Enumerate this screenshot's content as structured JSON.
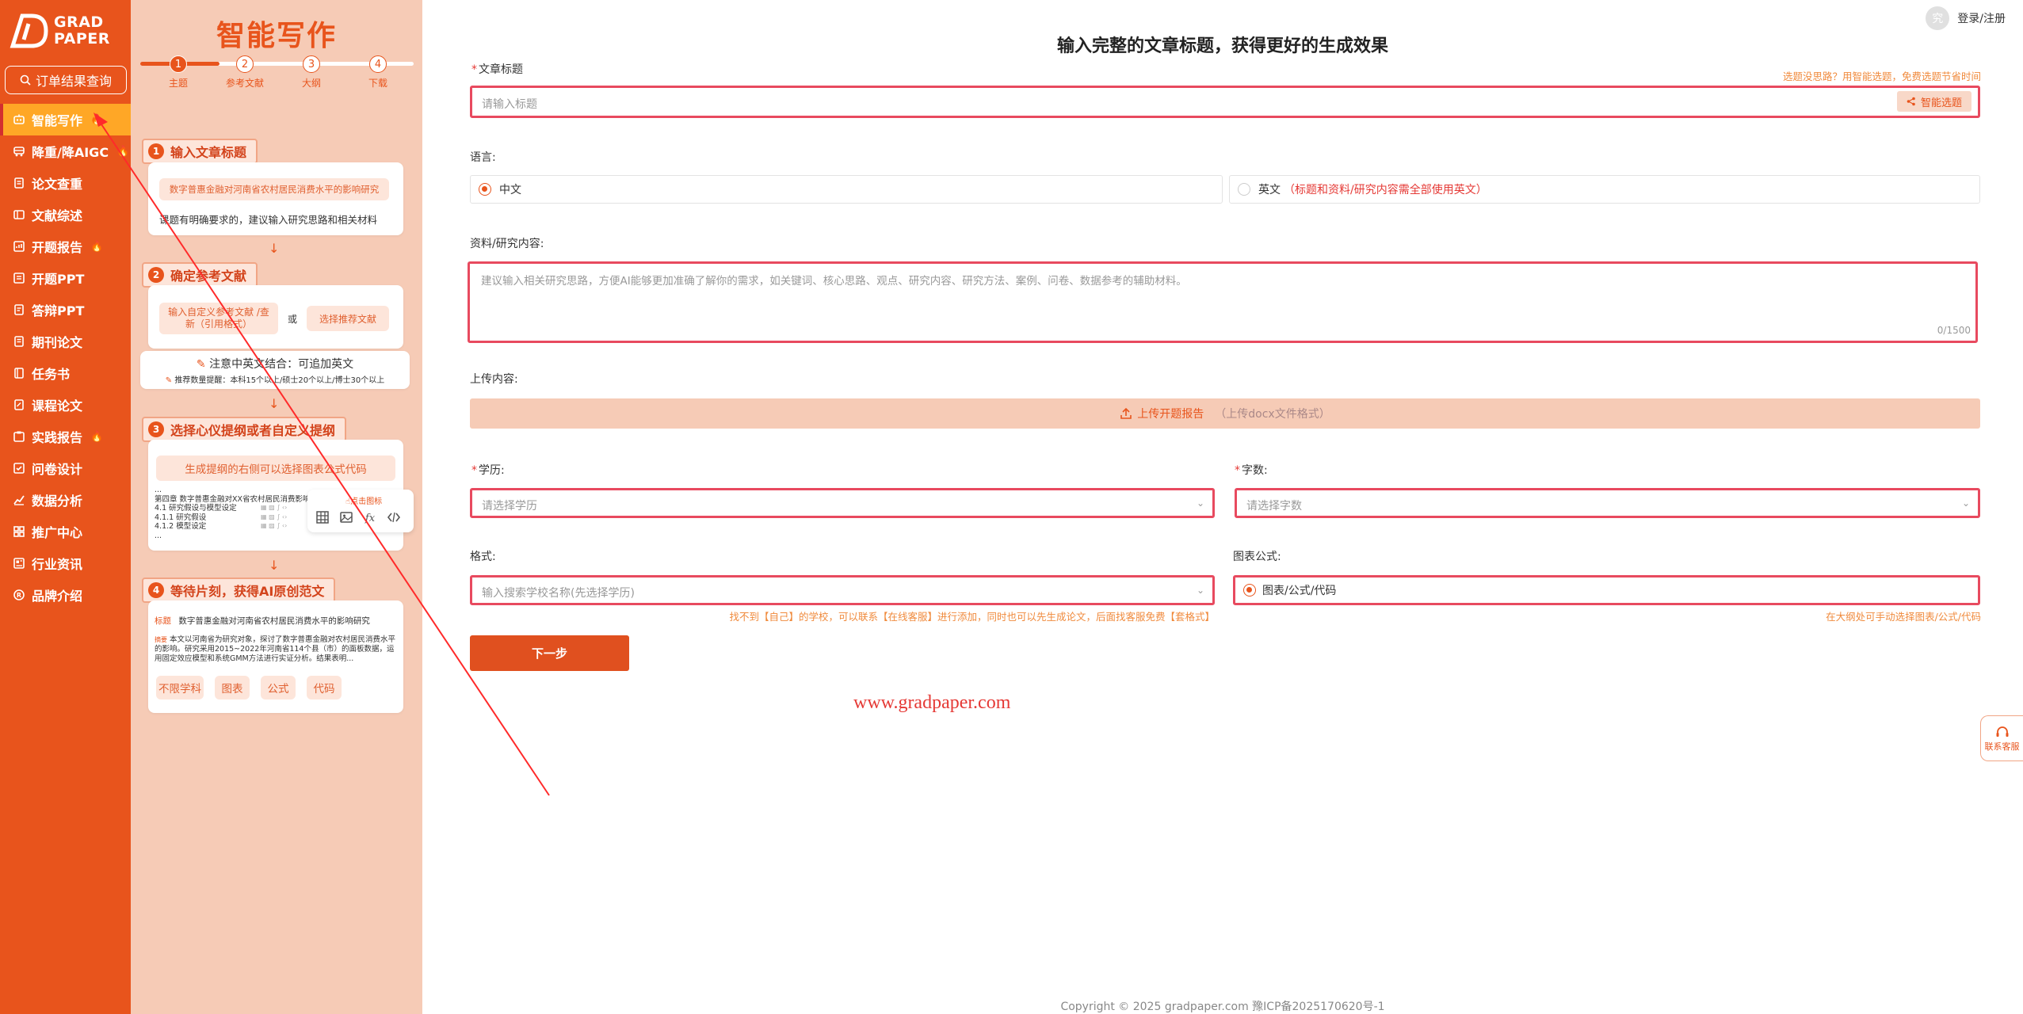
{
  "brand": {
    "name_line1": "GRAD",
    "name_line2": "PAPER"
  },
  "sidebar": {
    "order_query": "订单结果查询",
    "items": [
      {
        "label": "智能写作",
        "hot": true,
        "active": true
      },
      {
        "label": "降重/降AIGC",
        "hot": true
      },
      {
        "label": "论文查重"
      },
      {
        "label": "文献综述"
      },
      {
        "label": "开题报告",
        "hot": true
      },
      {
        "label": "开题PPT"
      },
      {
        "label": "答辩PPT"
      },
      {
        "label": "期刊论文"
      },
      {
        "label": "任务书"
      },
      {
        "label": "课程论文"
      },
      {
        "label": "实践报告",
        "hot": true
      },
      {
        "label": "问卷设计"
      },
      {
        "label": "数据分析"
      },
      {
        "label": "推广中心"
      },
      {
        "label": "行业资讯"
      },
      {
        "label": "品牌介绍"
      }
    ]
  },
  "guide": {
    "title": "智能写作",
    "steps": [
      {
        "num": "1",
        "label": "主题"
      },
      {
        "num": "2",
        "label": "参考文献"
      },
      {
        "num": "3",
        "label": "大纲"
      },
      {
        "num": "4",
        "label": "下载"
      }
    ],
    "s1": {
      "num": "1",
      "head": "输入文章标题",
      "example": "数字普惠金融对河南省农村居民消费水平的影响研究",
      "tip": "课题有明确要求的，建议输入研究思路和相关材料"
    },
    "s2": {
      "num": "2",
      "head": "确定参考文献",
      "opt_a": "输入自定义参考文献 /查新（引用格式）",
      "or": "或",
      "opt_b": "选择推荐文献",
      "note": "注意中英文结合：可追加英文",
      "count": "推荐数量提醒：本科15个以上/硕士20个以上/博士30个以上"
    },
    "s3": {
      "num": "3",
      "head": "选择心仪提纲或者自定义提纲",
      "pill": "生成提纲的右侧可以选择图表公式代码",
      "outline": [
        "...",
        "第四章 数字普惠金融对XX省农村居民消费影响",
        "4.1 研究假设与模型设定",
        "4.1.1 研究假设",
        "4.1.2 模型设定",
        "..."
      ],
      "icon_label": "点击图标"
    },
    "s4": {
      "num": "4",
      "head": "等待片刻，获得AI原创范文",
      "title_tag": "标题",
      "title_text": "数字普惠金融对河南省农村居民消费水平的影响研究",
      "abs_tag": "摘要",
      "abs_text": "本文以河南省为研究对象，探讨了数字普惠金融对农村居民消费水平的影响。研究采用2015~2022年河南省114个县（市）的面板数据，运用固定效应模型和系统GMM方法进行实证分析。结果表明...",
      "tags": [
        "不限学科",
        "图表",
        "公式",
        "代码"
      ]
    }
  },
  "header": {
    "title": "输入完整的文章标题，获得更好的生成效果",
    "login": "登录/注册",
    "avatar_glyph": "究"
  },
  "form": {
    "title_label": "文章标题",
    "title_hint": "选题没思路？用智能选题，免费选题节省时间",
    "title_placeholder": "请输入标题",
    "smart_topic": "智能选题",
    "lang_label": "语言:",
    "lang_cn": "中文",
    "lang_en": "英文",
    "lang_en_note": "（标题和资料/研究内容需全部使用英文）",
    "material_label": "资料/研究内容:",
    "material_placeholder": "建议输入相关研究思路，方便AI能够更加准确了解你的需求，如关键词、核心思路、观点、研究内容、研究方法、案例、问卷、数据参考的辅助材料。",
    "material_count": "0/1500",
    "upload_label": "上传内容:",
    "upload_btn": "上传开题报告",
    "upload_sub": "（上传docx文件格式）",
    "edu_label": "学历:",
    "edu_placeholder": "请选择学历",
    "words_label": "字数:",
    "words_placeholder": "请选择字数",
    "format_label": "格式:",
    "format_placeholder": "输入搜索学校名称(先选择学历)",
    "format_hint": "找不到【自己】的学校，可以联系【在线客服】进行添加，同时也可以先生成论文，后面找客服免费【套格式】",
    "chart_label": "图表公式:",
    "chart_option": "图表/公式/代码",
    "chart_hint": "在大纲处可手动选择图表/公式/代码",
    "next": "下一步"
  },
  "watermark": "www.gradpaper.com",
  "copyright": "Copyright © 2025 gradpaper.com 豫ICP备2025170620号-1",
  "contact": "联系客服",
  "colors": {
    "brand": "#e8541c",
    "panel": "#f6cbb6",
    "highlight": "#e84a5f",
    "active_nav": "#ffa726"
  }
}
